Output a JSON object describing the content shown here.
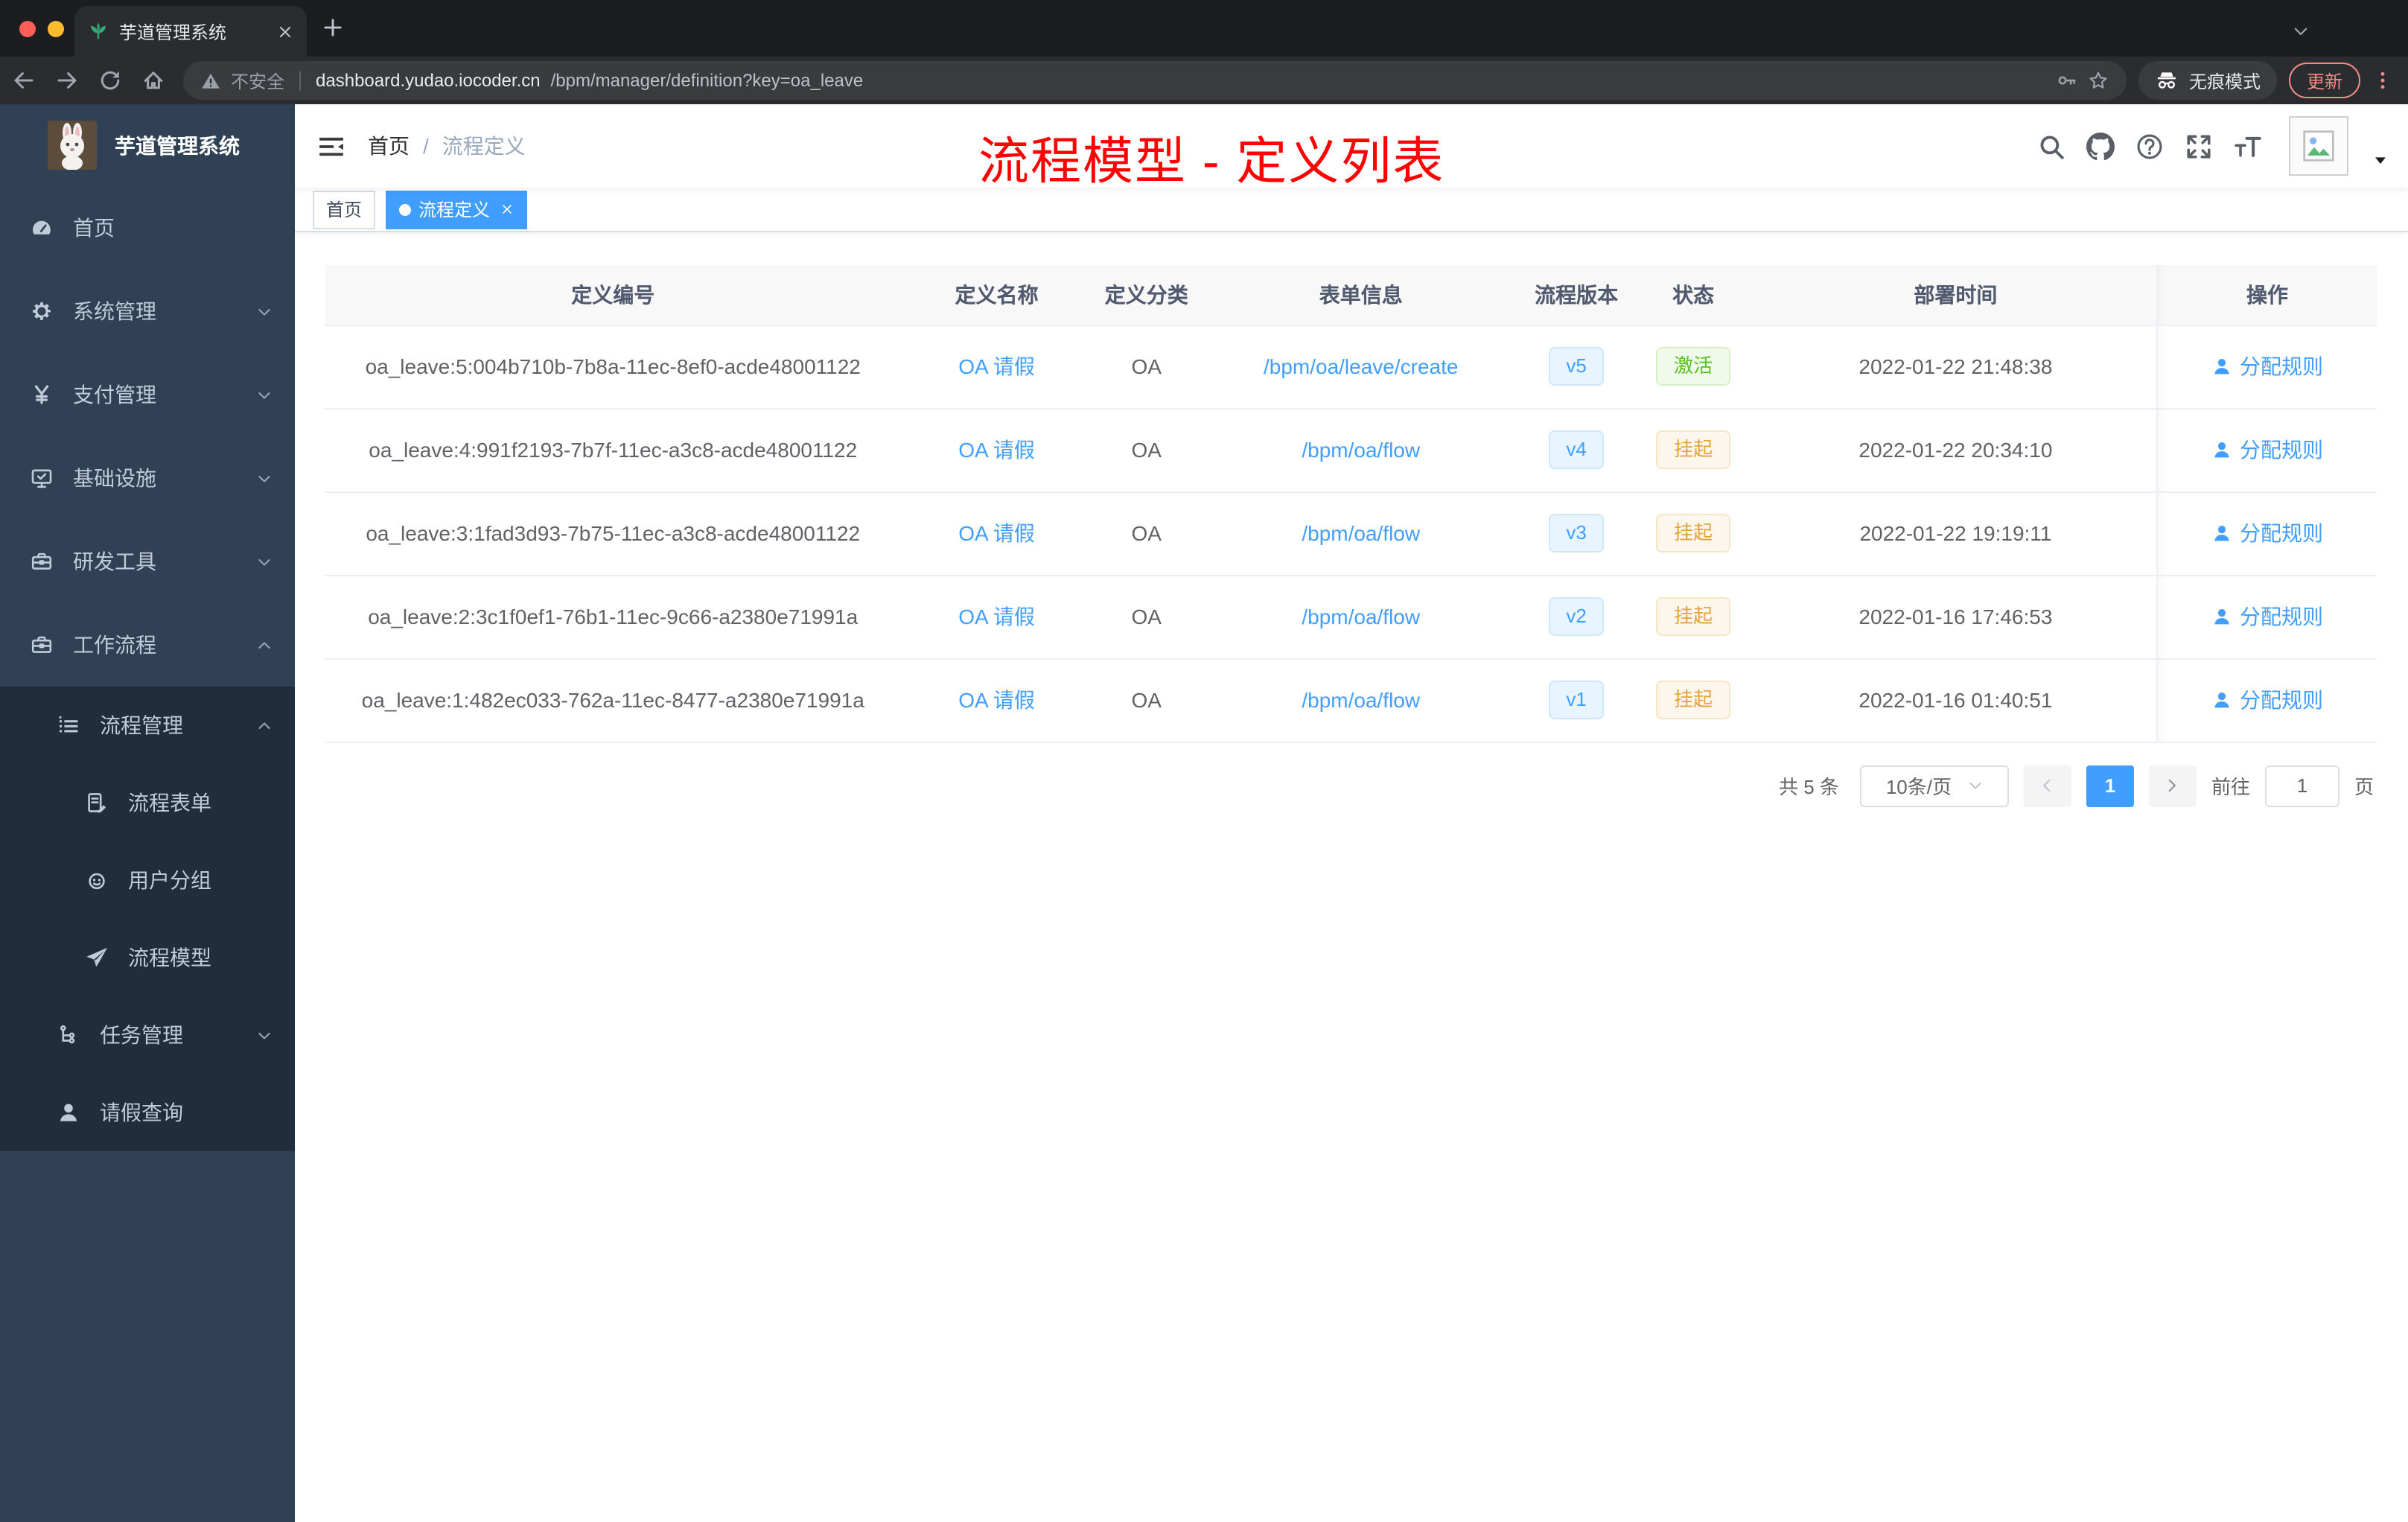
{
  "colors": {
    "accent": "#409eff",
    "annotation_red": "#fe0100",
    "sidebar_bg": "#304156",
    "sidebar_sub_bg": "#1f2d3d",
    "status_active_green": "#52c41a",
    "status_suspend_orange": "#e6a23c",
    "update_button_red": "#f28b82"
  },
  "browser": {
    "tab": {
      "title": "芋道管理系统",
      "favicon": "sprout-icon",
      "close_icon": "close-icon"
    },
    "new_tab_icon": "plus-icon",
    "strip_chevron_icon": "chevron-down-icon",
    "nav_icons": [
      "back-icon",
      "forward-icon",
      "reload-icon",
      "home-icon"
    ],
    "address": {
      "warning_icon": "warning-icon",
      "security_label": "不安全",
      "host": "dashboard.yudao.iocoder.cn",
      "path": "/bpm/manager/definition?key=oa_leave",
      "key_icon": "key-icon",
      "star_icon": "star-icon"
    },
    "incognito": {
      "icon": "incognito-icon",
      "label": "无痕模式"
    },
    "update_label": "更新",
    "menu_icon": "kebab-icon"
  },
  "sidebar": {
    "logo_title": "芋道管理系统",
    "logo_icon": "rabbit-avatar",
    "items": [
      {
        "name": "sidebar-item-home",
        "label": "首页",
        "icon": "dashboard-gauge-icon",
        "level": 1,
        "sub": false,
        "arrow": null
      },
      {
        "name": "sidebar-item-system-management",
        "label": "系统管理",
        "icon": "gear-icon",
        "level": 1,
        "sub": false,
        "arrow": "down"
      },
      {
        "name": "sidebar-item-payment-management",
        "label": "支付管理",
        "icon": "yen-icon",
        "level": 1,
        "sub": false,
        "arrow": "down"
      },
      {
        "name": "sidebar-item-infrastructure",
        "label": "基础设施",
        "icon": "monitor-icon",
        "level": 1,
        "sub": false,
        "arrow": "down"
      },
      {
        "name": "sidebar-item-dev-tools",
        "label": "研发工具",
        "icon": "toolbox-icon",
        "level": 1,
        "sub": false,
        "arrow": "down"
      },
      {
        "name": "sidebar-item-workflow",
        "label": "工作流程",
        "icon": "toolbox-icon",
        "level": 1,
        "sub": false,
        "arrow": "up"
      },
      {
        "name": "sidebar-item-process-management",
        "label": "流程管理",
        "icon": "list-icon",
        "level": 2,
        "sub": true,
        "arrow": "up"
      },
      {
        "name": "sidebar-item-process-form",
        "label": "流程表单",
        "icon": "form-edit-icon",
        "level": 3,
        "sub": true,
        "arrow": null
      },
      {
        "name": "sidebar-item-user-group",
        "label": "用户分组",
        "icon": "people-icon",
        "level": 3,
        "sub": true,
        "arrow": null
      },
      {
        "name": "sidebar-item-process-model",
        "label": "流程模型",
        "icon": "paper-plane-icon",
        "level": 3,
        "sub": true,
        "arrow": null
      },
      {
        "name": "sidebar-item-task-management",
        "label": "任务管理",
        "icon": "org-tree-icon",
        "level": 2,
        "sub": true,
        "arrow": "down"
      },
      {
        "name": "sidebar-item-leave-query",
        "label": "请假查询",
        "icon": "user-icon",
        "level": 2,
        "sub": true,
        "arrow": null
      }
    ]
  },
  "header": {
    "hamburger_icon": "hamburger-icon",
    "breadcrumb": [
      "首页",
      "流程定义"
    ],
    "breadcrumb_separator": "/",
    "right_icons": [
      "search-icon",
      "github-icon",
      "question-icon",
      "fullscreen-icon",
      "fontsize-icon"
    ],
    "avatar_icon": "image-placeholder-icon",
    "caret_icon": "caret-down-icon"
  },
  "annotation": {
    "text": "流程模型 - 定义列表"
  },
  "tags": [
    {
      "label": "首页",
      "active": false,
      "closable": false
    },
    {
      "label": "流程定义",
      "active": true,
      "closable": true
    }
  ],
  "table": {
    "columns": [
      "定义编号",
      "定义名称",
      "定义分类",
      "表单信息",
      "流程版本",
      "状态",
      "部署时间",
      "操作"
    ],
    "rows": [
      {
        "id": "oa_leave:5:004b710b-7b8a-11ec-8ef0-acde48001122",
        "name": "OA 请假",
        "category": "OA",
        "form": "/bpm/oa/leave/create",
        "version": "v5",
        "status": "激活",
        "status_type": "success",
        "deploy_time": "2022-01-22 21:48:38",
        "action": "分配规则",
        "action_icon": "user-icon"
      },
      {
        "id": "oa_leave:4:991f2193-7b7f-11ec-a3c8-acde48001122",
        "name": "OA 请假",
        "category": "OA",
        "form": "/bpm/oa/flow",
        "version": "v4",
        "status": "挂起",
        "status_type": "warning",
        "deploy_time": "2022-01-22 20:34:10",
        "action": "分配规则",
        "action_icon": "user-icon"
      },
      {
        "id": "oa_leave:3:1fad3d93-7b75-11ec-a3c8-acde48001122",
        "name": "OA 请假",
        "category": "OA",
        "form": "/bpm/oa/flow",
        "version": "v3",
        "status": "挂起",
        "status_type": "warning",
        "deploy_time": "2022-01-22 19:19:11",
        "action": "分配规则",
        "action_icon": "user-icon"
      },
      {
        "id": "oa_leave:2:3c1f0ef1-76b1-11ec-9c66-a2380e71991a",
        "name": "OA 请假",
        "category": "OA",
        "form": "/bpm/oa/flow",
        "version": "v2",
        "status": "挂起",
        "status_type": "warning",
        "deploy_time": "2022-01-16 17:46:53",
        "action": "分配规则",
        "action_icon": "user-icon"
      },
      {
        "id": "oa_leave:1:482ec033-762a-11ec-8477-a2380e71991a",
        "name": "OA 请假",
        "category": "OA",
        "form": "/bpm/oa/flow",
        "version": "v1",
        "status": "挂起",
        "status_type": "warning",
        "deploy_time": "2022-01-16 01:40:51",
        "action": "分配规则",
        "action_icon": "user-icon"
      }
    ]
  },
  "pagination": {
    "total_label": "共 5 条",
    "page_size_label": "10条/页",
    "prev_icon": "chevron-left-icon",
    "current_page": "1",
    "next_icon": "chevron-right-icon",
    "jumper_prefix": "前往",
    "jumper_value": "1",
    "jumper_suffix": "页"
  }
}
